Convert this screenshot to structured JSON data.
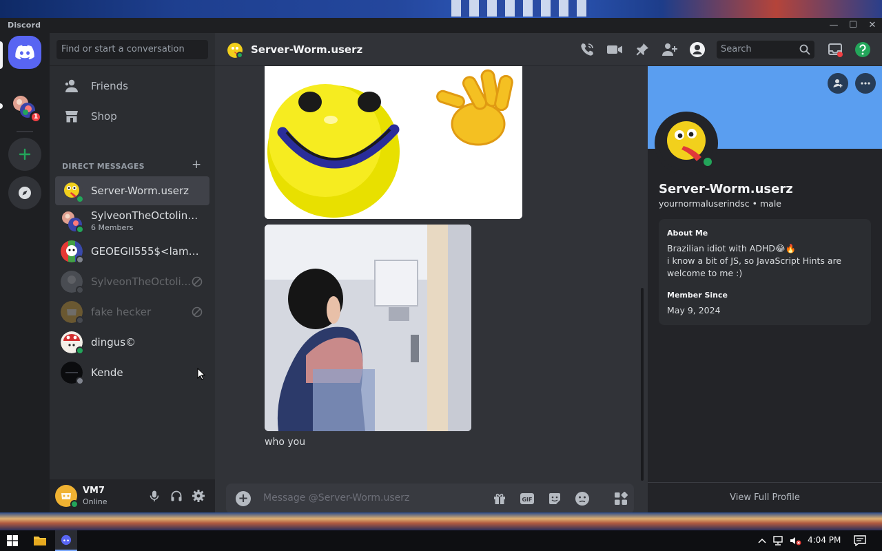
{
  "window": {
    "app_title": "Discord",
    "controls": {
      "minimize": "—",
      "maximize": "☐",
      "close": "✕"
    }
  },
  "rail": {
    "unread_badge": "1"
  },
  "sidebar": {
    "search_placeholder": "Find or start a conversation",
    "nav": [
      {
        "label": "Friends",
        "icon": "friends-icon"
      },
      {
        "label": "Shop",
        "icon": "shop-icon"
      }
    ],
    "dm_header": "DIRECT MESSAGES",
    "dm_add": "+",
    "dms": [
      {
        "name": "Server-Worm.userz",
        "status": "online"
      },
      {
        "name": "SylveonTheOctoling, ...",
        "sub": "6 Members"
      },
      {
        "name": "GEOEGII555$<lambd...",
        "status": "offline"
      },
      {
        "name": "SylveonTheOctoli...",
        "status": "blocked"
      },
      {
        "name": "fake hecker",
        "status": "blocked"
      },
      {
        "name": "dingus©",
        "status": "online"
      },
      {
        "name": "Kende",
        "status": "offline"
      }
    ],
    "user": {
      "name": "VM7",
      "status": "Online"
    }
  },
  "chat": {
    "title": "Server-Worm.userz",
    "search_placeholder": "Search",
    "message_text": "who you",
    "composer_placeholder": "Message @Server-Worm.userz",
    "gif_label": "GIF"
  },
  "profile": {
    "display_name": "Server-Worm.userz",
    "username_line": "yournormaluserindsc • male",
    "about_heading": "About Me",
    "about_line1": "Brazilian idiot with ADHD😂🔥",
    "about_line2": "i know a bit of JS, so JavaScript Hints are welcome to me :)",
    "member_since_heading": "Member Since",
    "member_since": "May 9, 2024",
    "view_full": "View Full Profile"
  },
  "taskbar": {
    "time": "4:04 PM"
  },
  "colors": {
    "blurple": "#5865f2",
    "online": "#23a55a",
    "offline": "#80848e",
    "badge_red": "#f23f43",
    "banner": "#5a9ef0"
  }
}
